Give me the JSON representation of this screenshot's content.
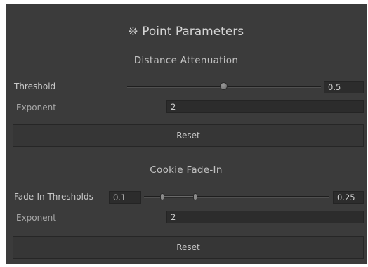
{
  "header": {
    "icon": "sun-icon",
    "title": "Point Parameters"
  },
  "distance_attenuation": {
    "title": "Distance Attenuation",
    "threshold": {
      "label": "Threshold",
      "value": "0.5",
      "slider_fraction": 0.5
    },
    "exponent": {
      "label": "Exponent",
      "value": "2"
    },
    "reset_label": "Reset"
  },
  "cookie_fade_in": {
    "title": "Cookie Fade-In",
    "thresholds": {
      "label": "Fade-In Thresholds",
      "min_value": "0.1",
      "max_value": "0.25",
      "range_min_fraction": 0.1,
      "range_max_fraction": 0.25
    },
    "exponent": {
      "label": "Exponent",
      "value": "2"
    },
    "reset_label": "Reset"
  }
}
